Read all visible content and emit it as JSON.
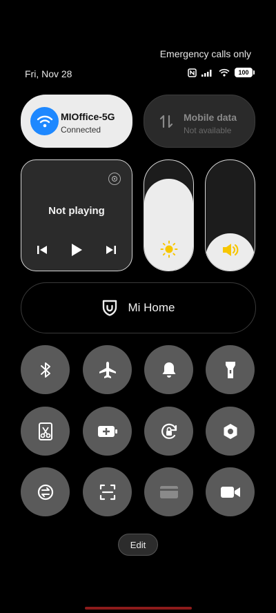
{
  "status": {
    "carrier_text": "Emergency calls only",
    "date": "Fri, Nov 28",
    "battery": "100"
  },
  "wifi": {
    "name": "MIOffice-5G",
    "status": "Connected"
  },
  "mobile_data": {
    "name": "Mobile data",
    "status": "Not available"
  },
  "media": {
    "title": "Not playing"
  },
  "brightness": {
    "level": 0.83
  },
  "volume": {
    "level": 0.34
  },
  "smart_home": {
    "label": "Mi Home"
  },
  "toggles": [
    "bluetooth-icon",
    "airplane-icon",
    "bell-icon",
    "flashlight-icon",
    "screenshot-icon",
    "battery-saver-icon",
    "rotation-lock-icon",
    "settings-icon",
    "sync-icon",
    "scanner-icon",
    "card-icon",
    "video-icon"
  ],
  "edit": {
    "label": "Edit"
  },
  "colors": {
    "accent_blue": "#1e88ff",
    "sun_yellow": "#f7c600"
  }
}
